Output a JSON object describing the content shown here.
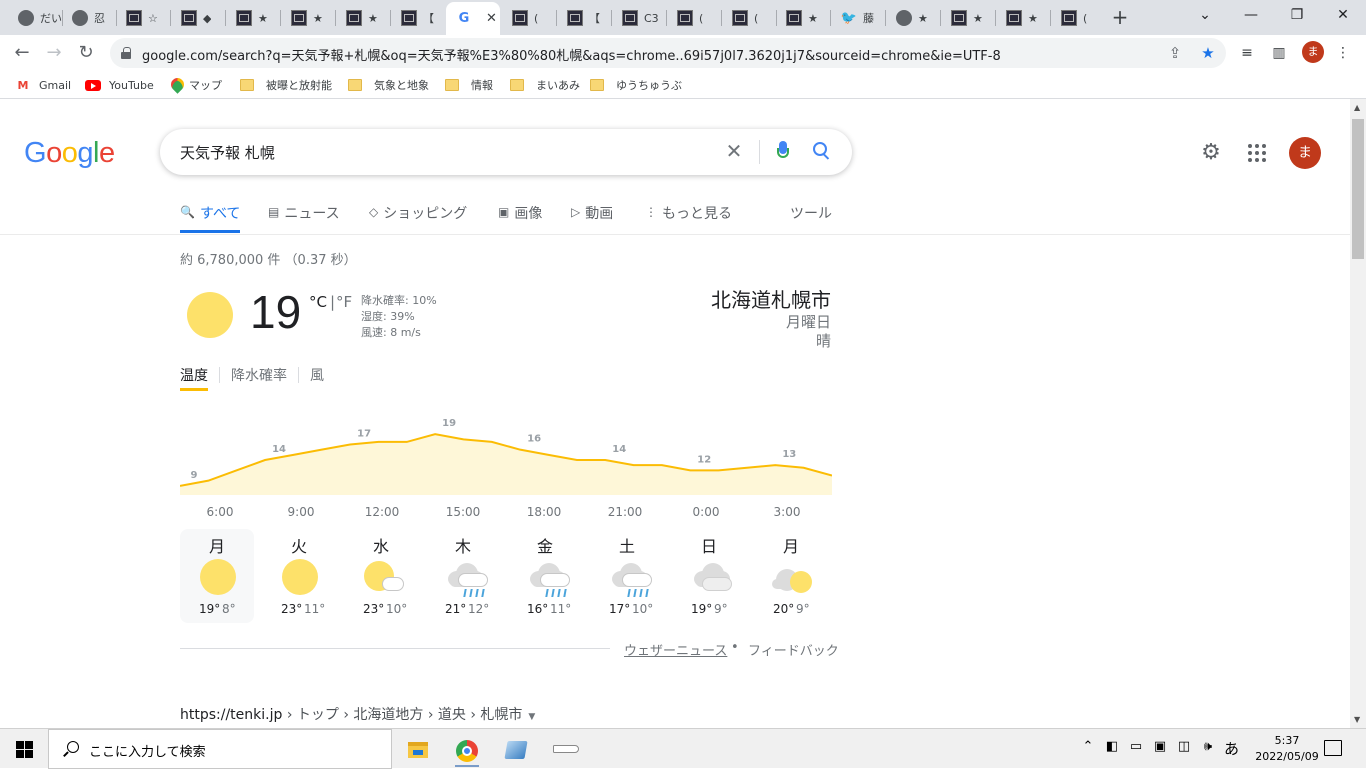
{
  "browser": {
    "tabs": [
      {
        "icon": "globe-icon",
        "title": "だい"
      },
      {
        "icon": "globe-icon",
        "title": "忍"
      },
      {
        "icon": "dark-thumb-icon",
        "title": "☆"
      },
      {
        "icon": "dark-thumb-icon",
        "title": "◆"
      },
      {
        "icon": "dark-thumb-icon",
        "title": "★"
      },
      {
        "icon": "dark-thumb-icon",
        "title": "★"
      },
      {
        "icon": "dark-thumb-icon",
        "title": "★"
      },
      {
        "icon": "dark-thumb-icon",
        "title": "【"
      },
      {
        "icon": "google-icon",
        "title": "",
        "active": true
      },
      {
        "icon": "dark-thumb-icon",
        "title": "("
      },
      {
        "icon": "dark-thumb-icon",
        "title": "【"
      },
      {
        "icon": "dark-thumb-icon",
        "title": "C3"
      },
      {
        "icon": "dark-thumb-icon",
        "title": "("
      },
      {
        "icon": "dark-thumb-icon",
        "title": "("
      },
      {
        "icon": "dark-thumb-icon",
        "title": "★"
      },
      {
        "icon": "twitter-icon",
        "title": "藤"
      },
      {
        "icon": "globe-icon",
        "title": "★"
      },
      {
        "icon": "dark-thumb-icon",
        "title": "★"
      },
      {
        "icon": "dark-thumb-icon",
        "title": "★"
      },
      {
        "icon": "dark-thumb-icon",
        "title": "("
      }
    ],
    "new_tab": "+",
    "url": "google.com/search?q=天気予報+札幌&oq=天気予報%E3%80%80札幌&aqs=chrome..69i57j0l7.3620j1j7&sourceid=chrome&ie=UTF-8",
    "profile_initial": "ま",
    "bookmarks": [
      {
        "type": "gmail",
        "label": "Gmail"
      },
      {
        "type": "youtube",
        "label": "YouTube"
      },
      {
        "type": "maps",
        "label": "マップ"
      },
      {
        "type": "folder",
        "label": "被曝と放射能"
      },
      {
        "type": "folder",
        "label": "気象と地象"
      },
      {
        "type": "folder",
        "label": "情報"
      },
      {
        "type": "folder",
        "label": "まいあみ"
      },
      {
        "type": "folder",
        "label": "ゆうちゅうぶ"
      }
    ]
  },
  "search": {
    "logo": [
      "G",
      "o",
      "o",
      "g",
      "l",
      "e"
    ],
    "query": "天気予報 札幌",
    "clear": "✕",
    "tabs": [
      {
        "icon": "search-icon",
        "glyph": "🔍",
        "label": "すべて",
        "active": true
      },
      {
        "icon": "news-icon",
        "glyph": "▤",
        "label": "ニュース"
      },
      {
        "icon": "tag-icon",
        "glyph": "◇",
        "label": "ショッピング"
      },
      {
        "icon": "image-icon",
        "glyph": "▣",
        "label": "画像"
      },
      {
        "icon": "video-icon",
        "glyph": "▷",
        "label": "動画"
      },
      {
        "icon": "more-icon",
        "glyph": "⋮",
        "label": "もっと見る"
      }
    ],
    "tools": "ツール",
    "result_stats": "約 6,780,000 件 （0.37 秒）",
    "avatar_initial": "ま"
  },
  "weather": {
    "current_temp": "19",
    "unit_c": "°C",
    "unit_sep": "|",
    "unit_f": "°F",
    "precip": "降水確率: 10%",
    "humidity": "湿度: 39%",
    "wind": "風速: 8 m/s",
    "location": "北海道札幌市",
    "day": "月曜日",
    "condition": "晴",
    "chart_tabs": [
      "温度",
      "降水確率",
      "風"
    ],
    "hours": [
      "6:00",
      "9:00",
      "12:00",
      "15:00",
      "18:00",
      "21:00",
      "0:00",
      "3:00"
    ],
    "daily": [
      {
        "day": "月",
        "icon": "sunny",
        "high": "19°",
        "low": "8°",
        "selected": true
      },
      {
        "day": "火",
        "icon": "sunny",
        "high": "23°",
        "low": "11°"
      },
      {
        "day": "水",
        "icon": "sun-cloud",
        "high": "23°",
        "low": "10°"
      },
      {
        "day": "木",
        "icon": "rain",
        "high": "21°",
        "low": "12°"
      },
      {
        "day": "金",
        "icon": "rain",
        "high": "16°",
        "low": "11°"
      },
      {
        "day": "土",
        "icon": "rain",
        "high": "17°",
        "low": "10°"
      },
      {
        "day": "日",
        "icon": "cloudy",
        "high": "19°",
        "low": "9°"
      },
      {
        "day": "月",
        "icon": "cloud-sun",
        "high": "20°",
        "low": "9°"
      }
    ],
    "weather_news": "ウェザーニュース",
    "dot": "•",
    "feedback": "フィードバック",
    "colors": {
      "line": "#fbbc04",
      "fill": "#fef7d8",
      "sun": "#fde16a"
    }
  },
  "chart_data": {
    "type": "area",
    "x": [
      "6:00",
      "7:00",
      "8:00",
      "9:00",
      "10:00",
      "11:00",
      "12:00",
      "13:00",
      "14:00",
      "15:00",
      "16:00",
      "17:00",
      "18:00",
      "19:00",
      "20:00",
      "21:00",
      "22:00",
      "23:00",
      "0:00",
      "1:00",
      "2:00",
      "3:00",
      "4:00",
      "5:00"
    ],
    "series": [
      {
        "values": [
          9,
          10,
          12,
          14,
          15,
          16,
          17,
          17.5,
          17.5,
          19,
          18,
          17.5,
          16,
          15,
          14,
          14,
          13,
          13,
          12,
          12,
          12.5,
          13,
          12.5,
          11
        ]
      }
    ],
    "data_labels": [
      {
        "x": "6:00",
        "label": "9"
      },
      {
        "x": "9:00",
        "label": "14"
      },
      {
        "x": "12:00",
        "label": "17"
      },
      {
        "x": "15:00",
        "label": "19"
      },
      {
        "x": "18:00",
        "label": "16"
      },
      {
        "x": "21:00",
        "label": "14"
      },
      {
        "x": "0:00",
        "label": "12"
      },
      {
        "x": "3:00",
        "label": "13"
      }
    ],
    "ylim": [
      0,
      20
    ]
  },
  "result": {
    "site": "https://tenki.jp",
    "crumbs": " › トップ › 北海道地方 › 道央 › 札幌市",
    "caret": "▼"
  },
  "taskbar": {
    "search_placeholder": "ここに入力して検索",
    "ime": "あ",
    "time": "5:37",
    "date": "2022/05/09"
  }
}
